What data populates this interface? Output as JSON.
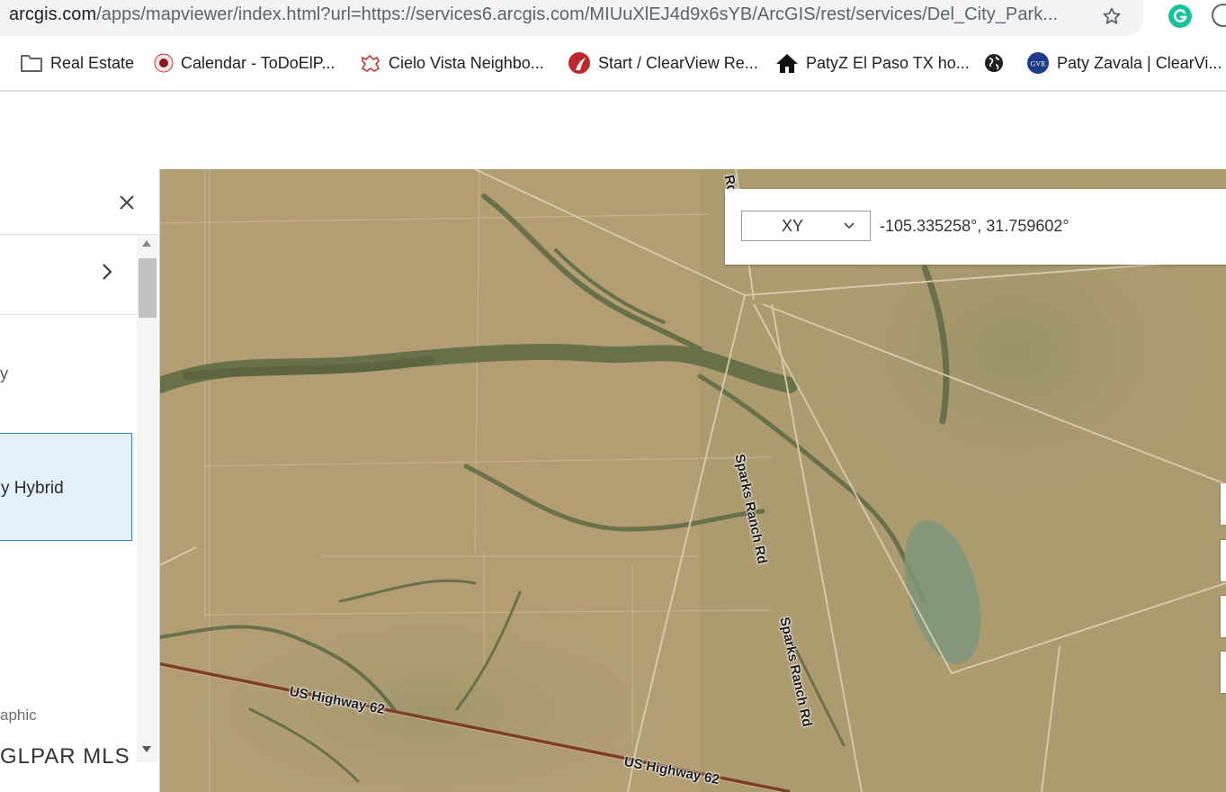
{
  "browser": {
    "url_domain": "arcgis.com",
    "url_path": "/apps/mapviewer/index.html?url=https://services6.arcgis.com/MIUuXlEJ4d9x6sYB/ArcGIS/rest/services/Del_City_Park...",
    "bookmarks": [
      {
        "label": "Real Estate",
        "icon": "folder-icon"
      },
      {
        "label": "Calendar - ToDoElP...",
        "icon": "calendar-site-icon"
      },
      {
        "label": "Cielo Vista Neighbo...",
        "icon": "cielo-vista-icon"
      },
      {
        "label": "Start / ClearView Re...",
        "icon": "clearview-icon"
      },
      {
        "label": "PatyZ El Paso TX ho...",
        "icon": "house-icon"
      },
      {
        "label": "",
        "icon": "globe-icon"
      },
      {
        "label": "Paty Zavala | ClearVi...",
        "icon": "gvr-icon"
      }
    ]
  },
  "panel": {
    "partial_text_1": "y",
    "selected_item": "y Hybrid",
    "partial_text_2": "aphic",
    "mls_text": "GLPAR MLS",
    "blue_fragment": "..."
  },
  "coordinates": {
    "format": "XY",
    "value": "-105.335258°, 31.759602°"
  },
  "map": {
    "road_labels": [
      "US Highway 62",
      "US Highway 62",
      "Sparks Ranch Rd",
      "Sparks Ranch Rd",
      "Rd"
    ]
  },
  "colors": {
    "accent": "#2f7fd8",
    "selected_bg": "#e3f0fc",
    "highway": "#8a4a2a"
  }
}
